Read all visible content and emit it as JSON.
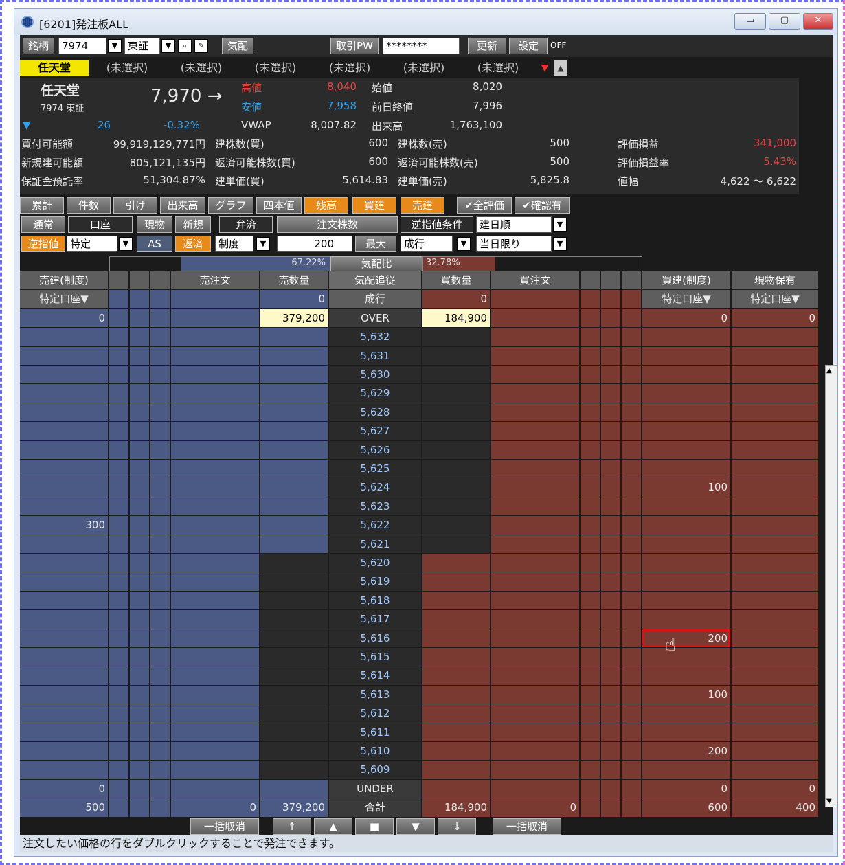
{
  "window": {
    "title": "[6201]発注板ALL",
    "btn_min": "▭",
    "btn_max": "▢",
    "btn_close": "✕"
  },
  "toolbar": {
    "symbol_label": "銘柄",
    "symbol_value": "7974",
    "market_value": "東証",
    "quote_label": "気配",
    "pw_label": "取引PW",
    "pw_value": "********",
    "update_label": "更新",
    "settings_label": "設定",
    "off_label": "OFF"
  },
  "tabs": [
    "任天堂",
    "(未選択)",
    "(未選択)",
    "(未選択)",
    "(未選択)",
    "(未選択)",
    "(未選択)"
  ],
  "stock": {
    "name": "任天堂",
    "code_market": "7974 東証",
    "price": "7,970 →",
    "change": "26",
    "change_pct": "-0.32%",
    "high_label": "高値",
    "high": "8,040",
    "low_label": "安値",
    "low": "7,958",
    "vwap_label": "VWAP",
    "vwap": "8,007.82",
    "open_label": "始値",
    "open": "8,020",
    "prev_label": "前日終値",
    "prev": "7,996",
    "volume_label": "出来高",
    "volume": "1,763,100"
  },
  "account": [
    {
      "l1": "買付可能額",
      "v1": "99,919,129,771円",
      "l2": "建株数(買)",
      "v2": "600",
      "l3": "建株数(売)",
      "v3": "500",
      "l4": "評価損益",
      "v4": "341,000"
    },
    {
      "l1": "新規建可能額",
      "v1": "805,121,135円",
      "l2": "返済可能株数(買)",
      "v2": "600",
      "l3": "返済可能株数(売)",
      "v3": "500",
      "l4": "評価損益率",
      "v4": "5.43%"
    },
    {
      "l1": "保証金預託率",
      "v1": "51,304.87%",
      "l2": "建単価(買)",
      "v2": "5,614.83",
      "l3": "建単価(売)",
      "v3": "5,825.8",
      "l4": "値幅",
      "v4": "4,622 〜 6,622"
    }
  ],
  "func_buttons": [
    "累計",
    "件数",
    "引け",
    "出来高",
    "グラフ",
    "四本値",
    "残高",
    "買建",
    "売建",
    "✔全評価",
    "✔確認有"
  ],
  "order": {
    "normal": "通常",
    "account_label": "口座",
    "genbutsu": "現物",
    "shinki": "新規",
    "bensai": "弁済",
    "qty_label": "注文株数",
    "stop_cond": "逆指値条件",
    "sort_value": "建日順",
    "stop": "逆指値",
    "account_value": "特定",
    "as_label": "AS",
    "hensai": "返済",
    "seido": "制度",
    "qty_value": "200",
    "max_label": "最大",
    "market_order": "成行",
    "validity": "当日限り"
  },
  "ratio": {
    "sell_pct": "67.22%",
    "label": "気配比",
    "buy_pct": "32.78%"
  },
  "headers": {
    "sell_margin": "売建(制度)",
    "sell_order": "売注文",
    "sell_qty": "売数量",
    "quote_follow": "気配追従",
    "buy_qty": "買数量",
    "buy_order": "買注文",
    "buy_margin": "買建(制度)",
    "holding": "現物保有",
    "acct_sub": "特定口座▼"
  },
  "market_row": {
    "label": "成行",
    "sell_qty": "0",
    "buy_qty": "0"
  },
  "over_row": {
    "label": "OVER",
    "sell_margin": "0",
    "sell_qty": "379,200",
    "buy_qty": "184,900",
    "buy_margin": "0",
    "holding": "0"
  },
  "prices": [
    "5,632",
    "5,631",
    "5,630",
    "5,629",
    "5,628",
    "5,627",
    "5,626",
    "5,625",
    "5,624",
    "5,623",
    "5,622",
    "5,621",
    "5,620",
    "5,619",
    "5,618",
    "5,617",
    "5,616",
    "5,615",
    "5,614",
    "5,613",
    "5,612",
    "5,611",
    "5,610",
    "5,609"
  ],
  "sell_margin_vals": {
    "5,622": "300"
  },
  "buy_margin_vals": {
    "5,624": "100",
    "5,616": "200",
    "5,613": "100",
    "5,610": "200"
  },
  "under_row": {
    "label": "UNDER",
    "sell_margin": "0",
    "buy_margin": "0",
    "holding": "0"
  },
  "total_row": {
    "label": "合計",
    "sell_margin": "500",
    "sell_order": "0",
    "sell_qty": "379,200",
    "buy_qty": "184,900",
    "buy_order": "0",
    "buy_margin": "600",
    "holding": "400"
  },
  "bottom": {
    "cancel_all_left": "一括取消",
    "up_top": "↑",
    "up": "▲",
    "stop": "■",
    "down": "▼",
    "down_bottom": "↓",
    "cancel_all_right": "一括取消"
  },
  "status_text": "注文したい価格の行をダブルクリックすることで発注できます。",
  "colors": {
    "sell": "#4a5a85",
    "buy": "#7a3a32",
    "center": "#2a2a2a",
    "accent": "#f0a020"
  }
}
